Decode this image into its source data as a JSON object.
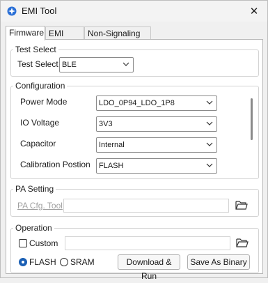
{
  "window": {
    "title": "EMI Tool",
    "close_glyph": "✕"
  },
  "tabs": [
    {
      "label": "Firmware",
      "active": true
    },
    {
      "label": "EMI Test",
      "active": false
    },
    {
      "label": "Non-Signaling Test",
      "active": false
    }
  ],
  "test_select": {
    "group_label": "Test Select",
    "label": "Test Select",
    "value": "BLE"
  },
  "configuration": {
    "group_label": "Configuration",
    "rows": [
      {
        "label": "Power Mode",
        "value": "LDO_0P94_LDO_1P8"
      },
      {
        "label": "IO Voltage",
        "value": "3V3"
      },
      {
        "label": "Capacitor",
        "value": "Internal"
      },
      {
        "label": "Calibration Postion",
        "value": "FLASH"
      }
    ]
  },
  "pa_setting": {
    "group_label": "PA Setting",
    "link_label": "PA Cfg. Tool",
    "path_value": ""
  },
  "operation": {
    "group_label": "Operation",
    "custom_label": "Custom",
    "custom_checked": false,
    "custom_path": "",
    "radio_flash": "FLASH",
    "radio_sram": "SRAM",
    "selected": "FLASH",
    "download_run_label": "Download & Run",
    "save_binary_label": "Save As Binary"
  },
  "colors": {
    "accent": "#1a5fb4"
  }
}
